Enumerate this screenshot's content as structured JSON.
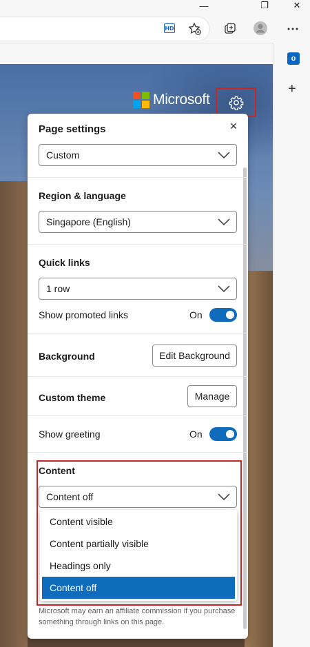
{
  "browser": {
    "hd_badge": "HD",
    "window_controls": [
      "—",
      "❐",
      "✕"
    ],
    "icons": [
      "hd-icon",
      "favorites-star-icon",
      "collections-icon",
      "profile-icon",
      "more-icon",
      "outlook-icon",
      "add-icon"
    ],
    "sidebar": {
      "outlook_letter": "o",
      "add_symbol": "+"
    }
  },
  "brand": {
    "name": "Microsoft",
    "logo_colors": [
      "#f25022",
      "#7fba00",
      "#00a4ef",
      "#ffb900"
    ]
  },
  "panel": {
    "title": "Page settings",
    "close_symbol": "✕",
    "layout_select": "Custom",
    "region": {
      "label": "Region & language",
      "value": "Singapore (English)"
    },
    "quick_links": {
      "label": "Quick links",
      "value": "1 row",
      "promoted_label": "Show promoted links",
      "promoted_state": "On"
    },
    "background": {
      "label": "Background",
      "button": "Edit Background"
    },
    "custom_theme": {
      "label": "Custom theme",
      "button": "Manage"
    },
    "greeting": {
      "label": "Show greeting",
      "state": "On"
    },
    "content": {
      "label": "Content",
      "value": "Content off",
      "options": [
        "Content visible",
        "Content partially visible",
        "Headings only",
        "Content off"
      ],
      "selected_index": 3
    },
    "footnote": "Microsoft may earn an affiliate commission if you purchase something through links on this page."
  },
  "colors": {
    "accent": "#0f6cbd",
    "highlight_box": "#c62828"
  }
}
